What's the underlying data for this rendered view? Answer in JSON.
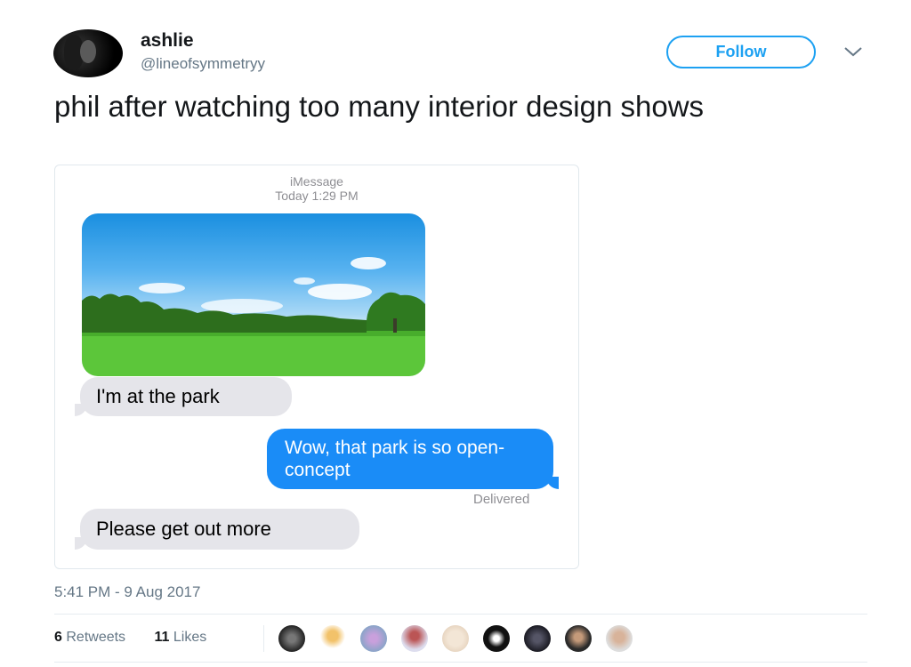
{
  "tweet": {
    "display_name": "ashlie",
    "handle": "@lineofsymmetryy",
    "follow_label": "Follow",
    "text": "phil after watching too many interior design shows",
    "timestamp": "5:41 PM - 9 Aug 2017",
    "retweets_count": "6",
    "retweets_label": "Retweets",
    "likes_count": "11",
    "likes_label": "Likes"
  },
  "imessage": {
    "service": "iMessage",
    "time": "Today 1:29 PM",
    "messages": [
      {
        "side": "in",
        "text": "I'm at the park"
      },
      {
        "side": "out",
        "text": "Wow, that park is so open-concept"
      },
      {
        "side": "in",
        "text": "Please get out more"
      }
    ],
    "status": "Delivered"
  },
  "colors": {
    "twitter_blue": "#1da1f2",
    "imessage_blue": "#1a8cf7",
    "bubble_gray": "#e5e5ea"
  },
  "liker_avatars": [
    "avatar-1",
    "avatar-2",
    "avatar-3",
    "avatar-4",
    "avatar-5",
    "avatar-6",
    "avatar-7",
    "avatar-8",
    "avatar-9"
  ]
}
